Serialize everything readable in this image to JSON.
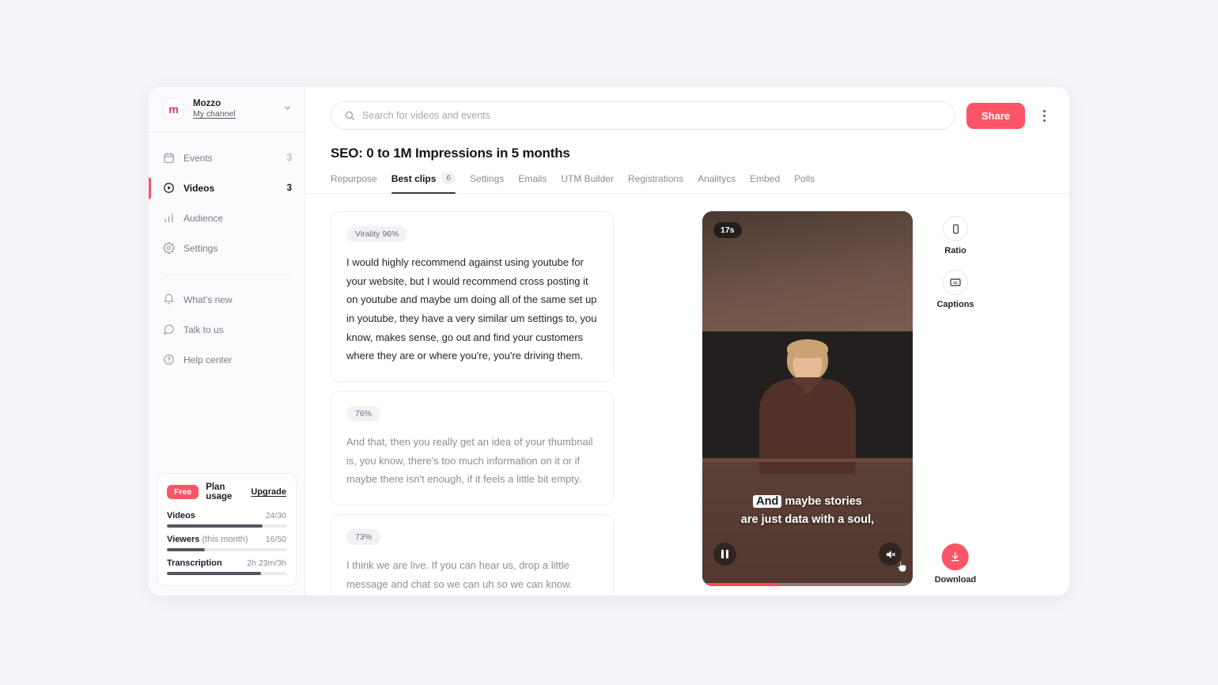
{
  "workspace": {
    "name": "Mozzo",
    "subtitle": "My channel",
    "logo_letter": "m",
    "chevron_icon": "chevron-down-icon"
  },
  "sidebar": {
    "items": [
      {
        "label": "Events",
        "count": "3",
        "icon": "calendar-icon",
        "active": false
      },
      {
        "label": "Videos",
        "count": "3",
        "icon": "play-circle-icon",
        "active": true
      },
      {
        "label": "Audience",
        "count": "",
        "icon": "bar-chart-icon",
        "active": false
      },
      {
        "label": "Settings",
        "count": "",
        "icon": "gear-icon",
        "active": false
      }
    ],
    "secondary": [
      {
        "label": "What's new",
        "icon": "bell-icon"
      },
      {
        "label": "Talk to us",
        "icon": "chat-bubble-icon"
      },
      {
        "label": "Help center",
        "icon": "question-circle-icon"
      }
    ]
  },
  "plan": {
    "badge": "Free",
    "title": "Plan usage",
    "upgrade": "Upgrade",
    "rows": [
      {
        "label": "Videos",
        "label_muted": "",
        "value": "24/30",
        "percent": 80
      },
      {
        "label": "Viewers",
        "label_muted": "(this month)",
        "value": "16/50",
        "percent": 32
      },
      {
        "label": "Transcription",
        "label_muted": "",
        "value": "2h 23m/3h",
        "percent": 79
      }
    ]
  },
  "search": {
    "placeholder": "Search for videos and events",
    "value": "",
    "icon": "search-icon"
  },
  "toolbar": {
    "share_label": "Share",
    "share_color": "#fb5567",
    "kebab_icon": "more-vertical-icon"
  },
  "page": {
    "title": "SEO: 0 to 1M Impressions in 5 months"
  },
  "tabs": [
    {
      "label": "Repurpose",
      "badge": "",
      "active": false
    },
    {
      "label": "Best clips",
      "badge": "6",
      "active": true
    },
    {
      "label": "Settings",
      "badge": "",
      "active": false
    },
    {
      "label": "Emails",
      "badge": "",
      "active": false
    },
    {
      "label": "UTM Builder",
      "badge": "",
      "active": false
    },
    {
      "label": "Registrations",
      "badge": "",
      "active": false
    },
    {
      "label": "Analitycs",
      "badge": "",
      "active": false
    },
    {
      "label": "Embed",
      "badge": "",
      "active": false
    },
    {
      "label": "Polls",
      "badge": "",
      "active": false
    }
  ],
  "clips": [
    {
      "score": "Virality 96%",
      "text": "I would highly recommend against using youtube for your website, but I would recommend cross posting it on youtube and maybe um doing all of the same set up in youtube, they have a very similar um settings to, you know, makes sense, go out and find your customers where they are or where you're, you're driving them.",
      "active": true
    },
    {
      "score": "76%",
      "text": "And that, then you really get an idea of your thumbnail is, you know, there's too much information on it or if maybe there isn't enough, if it feels a little bit empty.",
      "active": false
    },
    {
      "score": "73%",
      "text": "I think we are live. If you can hear us, drop a little message and chat so we can uh so we can know. Hello, everyone.",
      "active": false
    }
  ],
  "player": {
    "duration_badge": "17s",
    "caption_highlight": "And",
    "caption_line1_rest": "maybe stories",
    "caption_line2": "are just data with a soul,",
    "play_icon": "pause-icon",
    "mute_icon": "volume-muted-icon",
    "progress_percent": 36,
    "progress_color": "#fb4a5e",
    "cursor_icon": "pointer-cursor-icon"
  },
  "tools": [
    {
      "label": "Ratio",
      "icon": "phone-portrait-icon"
    },
    {
      "label": "Captions",
      "icon": "closed-caption-icon"
    }
  ],
  "download": {
    "label": "Download",
    "icon": "download-icon",
    "color": "#fb5567"
  }
}
